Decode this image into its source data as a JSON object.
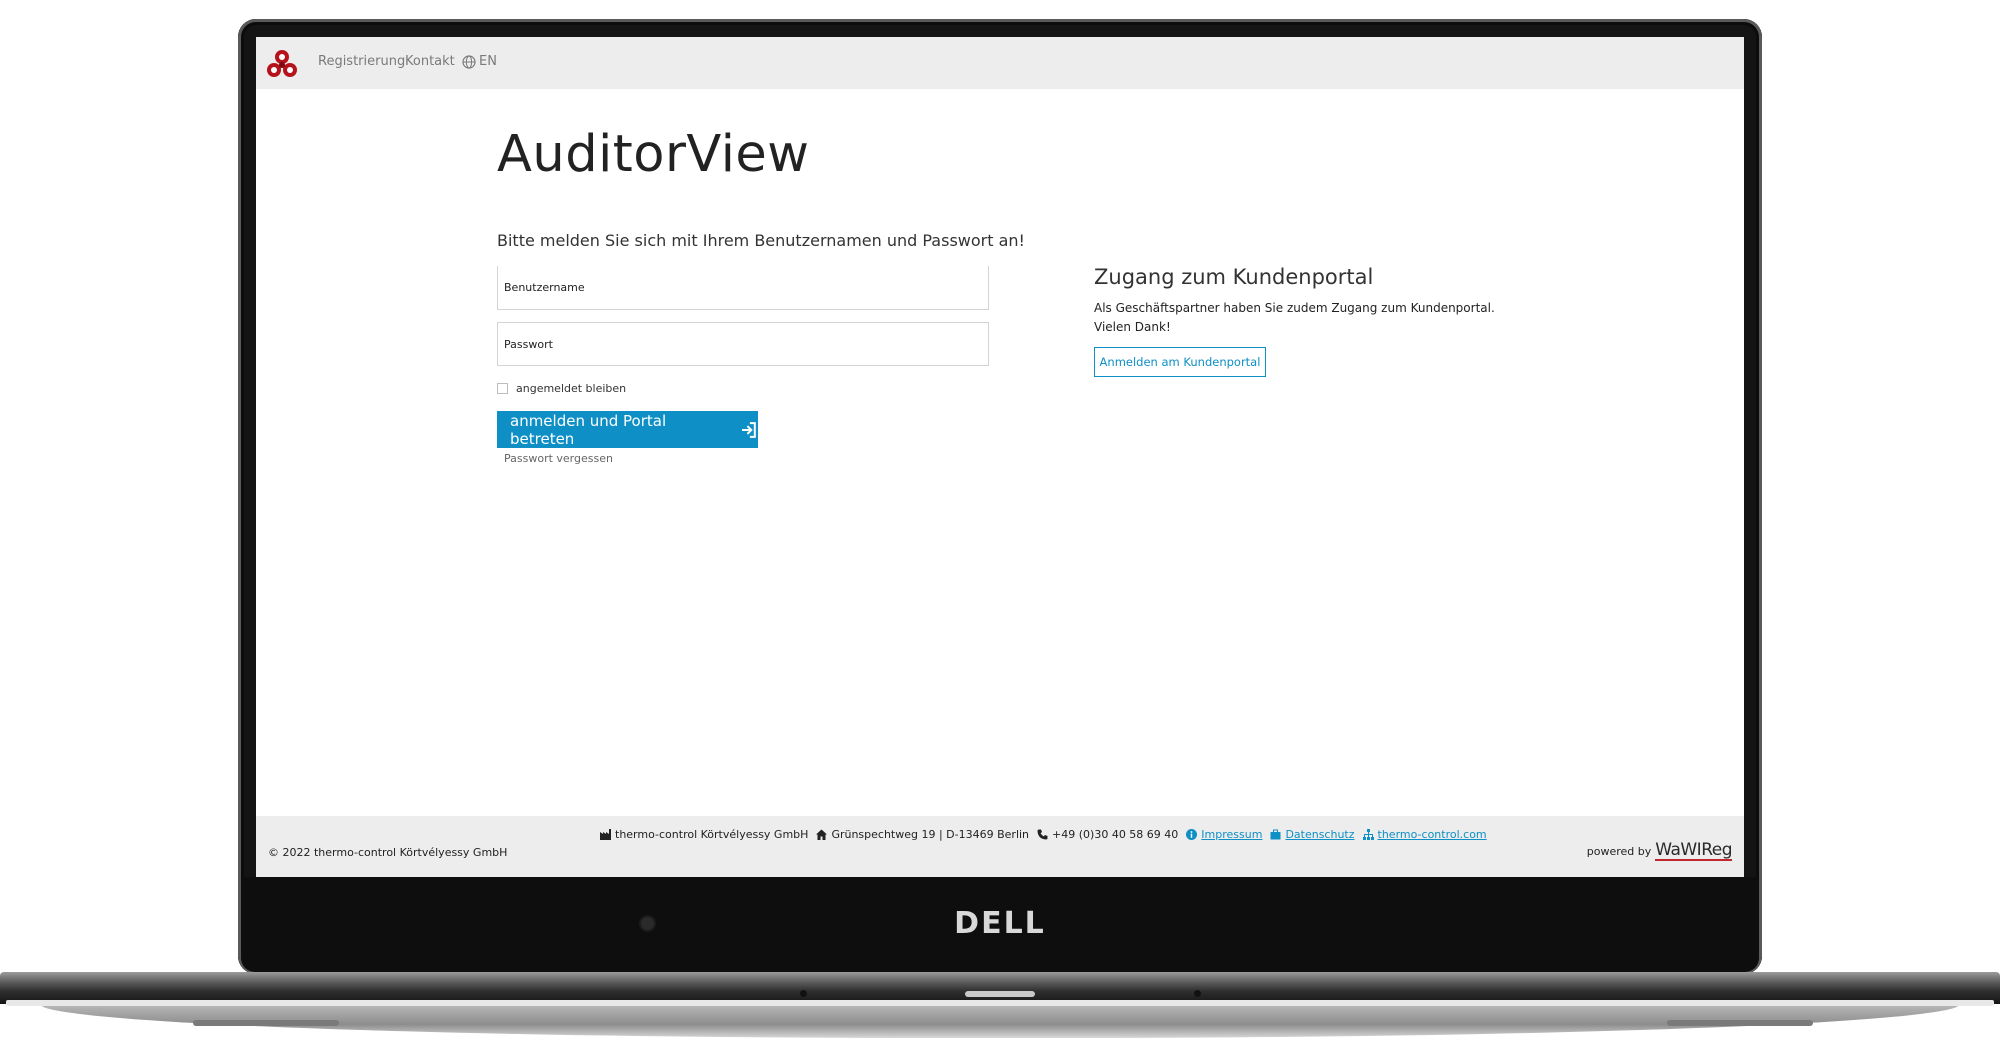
{
  "device": {
    "brand": "DELL"
  },
  "nav": {
    "items": [
      {
        "label": "Registrierung"
      },
      {
        "label": "Kontakt"
      },
      {
        "label": "EN"
      }
    ]
  },
  "login": {
    "app_title": "AuditorView",
    "intro": "Bitte melden Sie sich mit Ihrem Benutzernamen und Passwort an!",
    "username_placeholder": "Benutzername",
    "password_placeholder": "Passwort",
    "remember_label": "angemeldet bleiben",
    "submit_label": "anmelden und Portal betreten",
    "forgot_label": "Passwort vergessen"
  },
  "portal": {
    "title": "Zugang zum Kundenportal",
    "text": "Als Geschäftspartner haben Sie zudem Zugang zum Kundenportal. Vielen Dank!",
    "button_label": "Anmelden am Kundenportal"
  },
  "footer": {
    "company": "thermo-control Körtvélyessy GmbH",
    "address": "Grünspechtweg 19 | D-13469 Berlin",
    "phone": "+49 (0)30 40 58 69 40",
    "imprint": "Impressum",
    "privacy": "Datenschutz",
    "website": "thermo-control.com",
    "copyright": "© 2022 thermo-control Körtvélyessy GmbH",
    "powered_by": "powered by",
    "powered_logo": "WaWIReg"
  },
  "colors": {
    "accent": "#0e8fc5",
    "navbar_bg": "#ededed",
    "logo_red": "#b5121b"
  }
}
